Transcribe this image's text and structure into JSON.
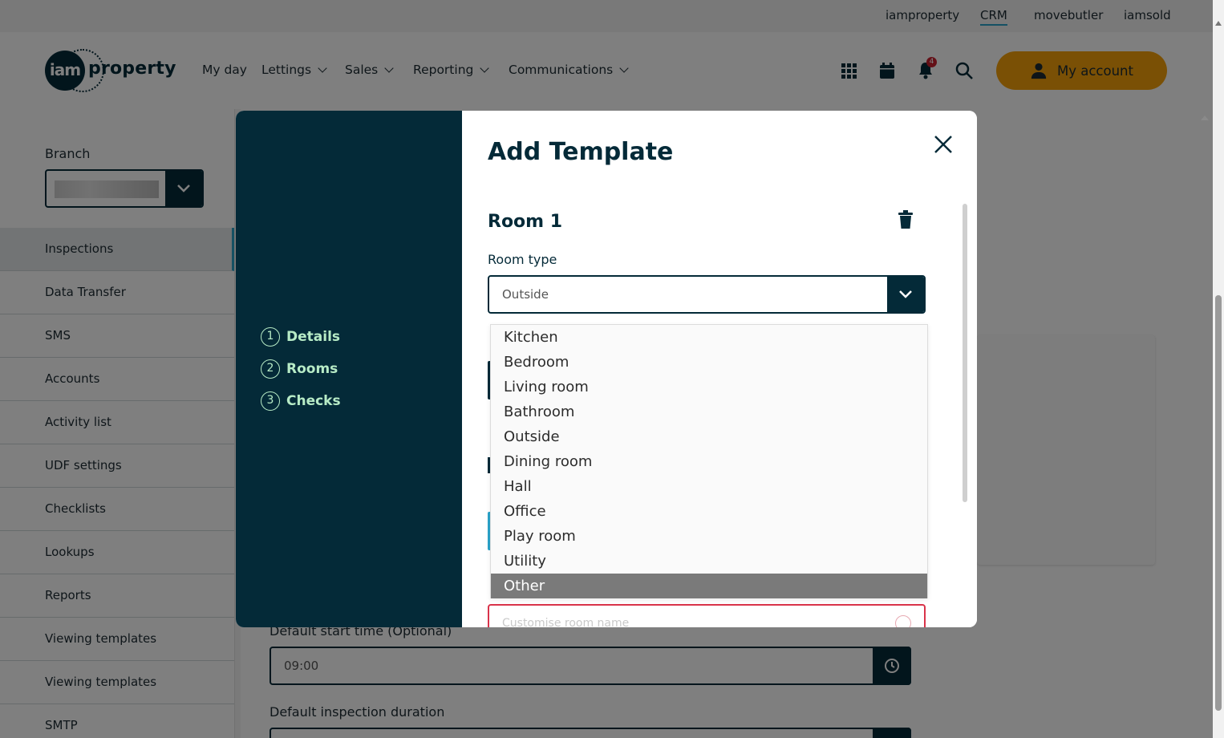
{
  "topbar": {
    "links": [
      "iamproperty",
      "CRM",
      "movebutler",
      "iamsold"
    ],
    "active": "CRM"
  },
  "header": {
    "logo_badge": "iam",
    "logo_text": "property",
    "nav": [
      "My day",
      "Lettings",
      "Sales",
      "Reporting",
      "Communications"
    ],
    "notification_count": "4",
    "account_label": "My account"
  },
  "sidebar": {
    "branch_label": "Branch",
    "items": [
      "Inspections",
      "Data Transfer",
      "SMS",
      "Accounts",
      "Activity list",
      "UDF settings",
      "Checklists",
      "Lookups",
      "Reports",
      "Viewing templates",
      "Viewing templates",
      "SMTP"
    ],
    "active": "Inspections"
  },
  "background_form": {
    "start_time_label": "Default start time (Optional)",
    "start_time_value": "09:00",
    "duration_label": "Default inspection duration"
  },
  "modal": {
    "title": "Add Template",
    "steps": [
      {
        "num": "1",
        "label": "Details"
      },
      {
        "num": "2",
        "label": "Rooms"
      },
      {
        "num": "3",
        "label": "Checks"
      }
    ],
    "room_title": "Room 1",
    "room_type_label": "Room type",
    "room_type_value": "Outside",
    "custom_name_placeholder": "Customise room name",
    "room_type_options": [
      "Kitchen",
      "Bedroom",
      "Living room",
      "Bathroom",
      "Outside",
      "Dining room",
      "Hall",
      "Office",
      "Play room",
      "Utility",
      "Other"
    ],
    "highlighted_option": "Other"
  },
  "colors": {
    "brand_dark": "#042a38",
    "accent_orange": "#f4a10a",
    "step_green": "#b7ebc6",
    "error_red": "#d9334a",
    "link_blue": "#2aa3c9"
  }
}
